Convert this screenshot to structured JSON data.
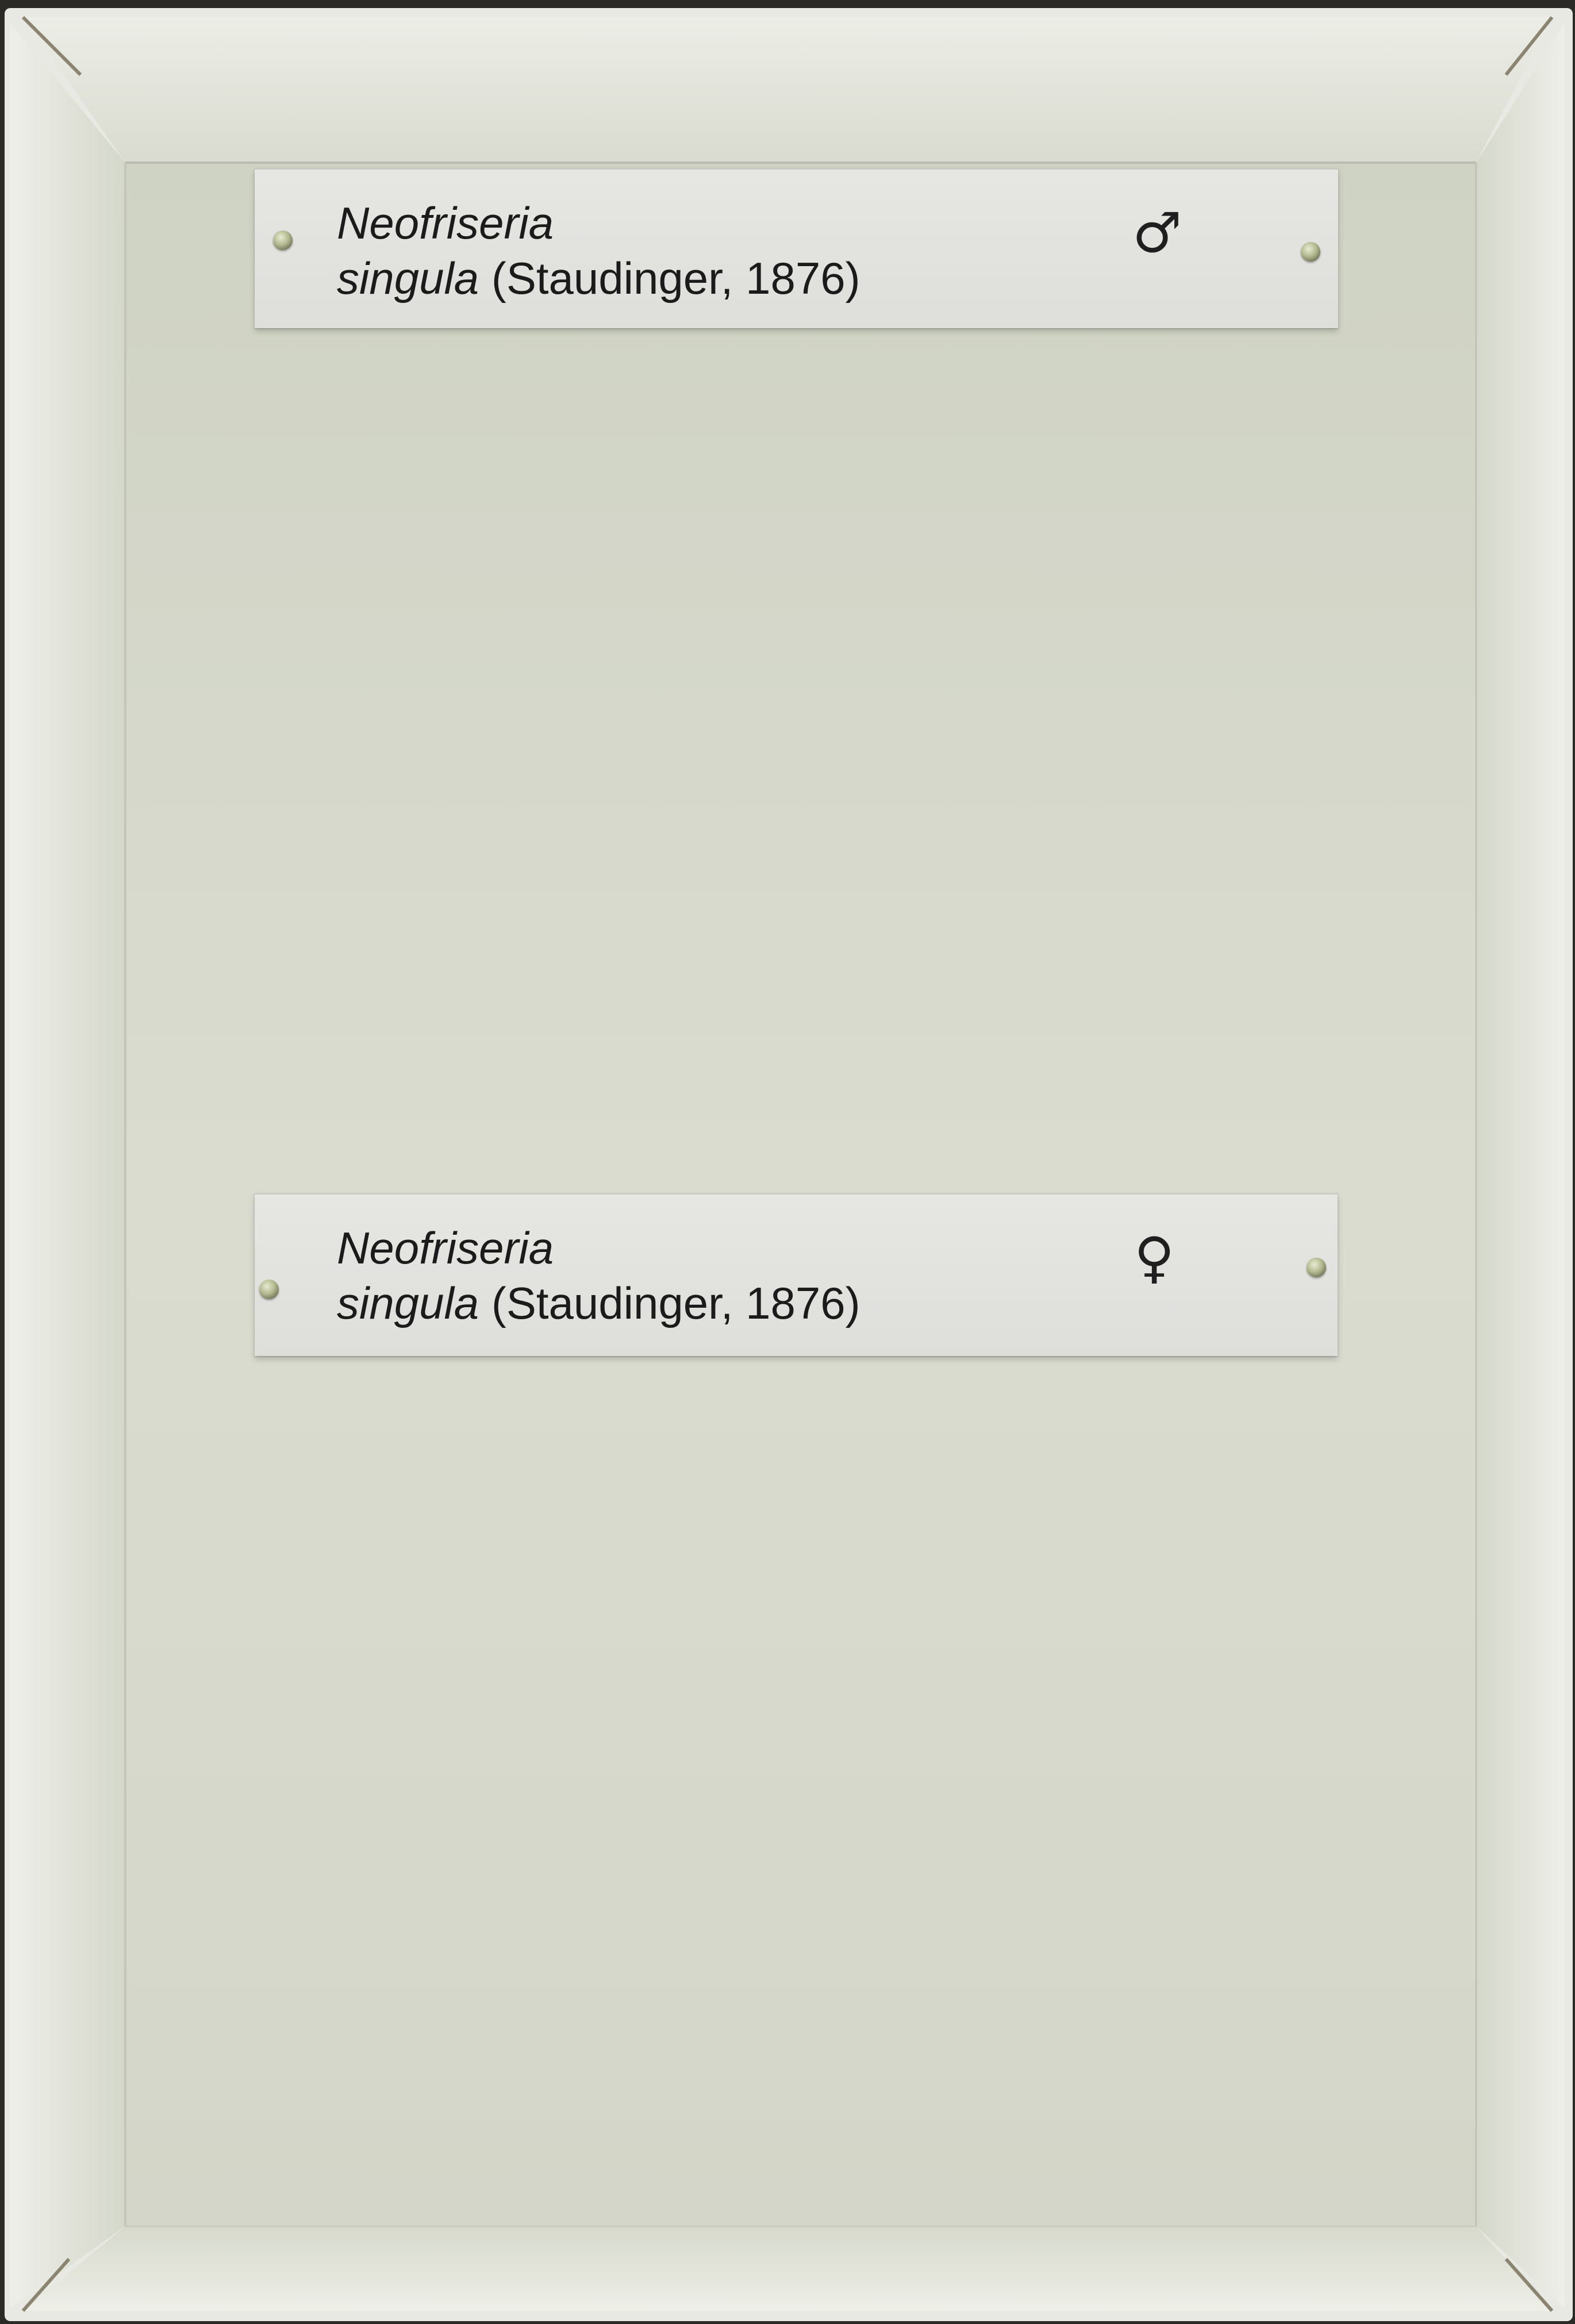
{
  "scene": {
    "type": "specimen drawer unit tray with labels",
    "colors": {
      "tray_floor": "#d8dbcd",
      "tray_wall": "#e4e6dd",
      "label": "#e3e3e0",
      "text": "#1b1b1b",
      "pin": "#b3b88f"
    }
  },
  "labels": [
    {
      "genus": "Neofriseria",
      "species": "singula",
      "author": " (Staudinger, 1876)",
      "sex_symbol": "♂",
      "sex_icon": "male-symbol-icon"
    },
    {
      "genus": "Neofriseria",
      "species": "singula",
      "author": " (Staudinger, 1876)",
      "sex_symbol": "♀",
      "sex_icon": "female-symbol-icon"
    }
  ]
}
